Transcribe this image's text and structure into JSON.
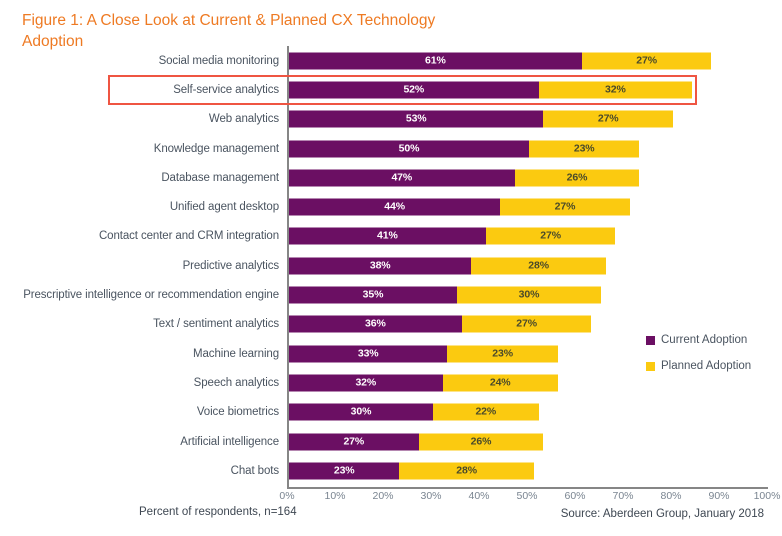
{
  "title": "Figure 1: A Close Look at Current & Planned CX Technology Adoption",
  "footer": {
    "left": "Percent of respondents, n=164",
    "right": "Source: Aberdeen Group, January 2018"
  },
  "colors": {
    "current": "#6b0f63",
    "planned": "#fbca10",
    "title": "#ee7a23",
    "highlight": "#ef5542",
    "axis": "#868686",
    "label": "#4a5460"
  },
  "highlight": {
    "category": "Self-service analytics"
  },
  "legend": {
    "position": "right",
    "items": [
      {
        "label": "Current Adoption",
        "color": "#6b0f63"
      },
      {
        "label": "Planned Adoption",
        "color": "#fbca10"
      }
    ]
  },
  "chart_data": {
    "type": "bar",
    "orientation": "horizontal",
    "stacked": true,
    "title": "Figure 1: A Close Look at Current & Planned CX Technology Adoption",
    "xlabel": "",
    "ylabel": "",
    "xlim": [
      0,
      100
    ],
    "grid": false,
    "tick_labels": [
      "0%",
      "10%",
      "20%",
      "30%",
      "40%",
      "50%",
      "60%",
      "70%",
      "80%",
      "90%",
      "100%"
    ],
    "tick_values": [
      0,
      10,
      20,
      30,
      40,
      50,
      60,
      70,
      80,
      90,
      100
    ],
    "categories": [
      "Social media monitoring",
      "Self-service analytics",
      "Web analytics",
      "Knowledge management",
      "Database management",
      "Unified agent desktop",
      "Contact center and CRM integration",
      "Predictive analytics",
      "Prescriptive intelligence or recommendation engine",
      "Text / sentiment analytics",
      "Machine learning",
      "Speech analytics",
      "Voice biometrics",
      "Artificial intelligence",
      "Chat bots"
    ],
    "series": [
      {
        "name": "Current Adoption",
        "color": "#6b0f63",
        "values": [
          61,
          52,
          53,
          50,
          47,
          44,
          41,
          38,
          35,
          36,
          33,
          32,
          30,
          27,
          23
        ],
        "labels": [
          "61%",
          "52%",
          "53%",
          "50%",
          "47%",
          "44%",
          "41%",
          "38%",
          "35%",
          "36%",
          "33%",
          "32%",
          "30%",
          "27%",
          "23%"
        ]
      },
      {
        "name": "Planned Adoption",
        "color": "#fbca10",
        "values": [
          27,
          32,
          27,
          23,
          26,
          27,
          27,
          28,
          30,
          27,
          23,
          24,
          22,
          26,
          28
        ],
        "labels": [
          "27%",
          "32%",
          "27%",
          "23%",
          "26%",
          "27%",
          "27%",
          "28%",
          "30%",
          "27%",
          "23%",
          "24%",
          "22%",
          "26%",
          "28%"
        ]
      }
    ]
  }
}
